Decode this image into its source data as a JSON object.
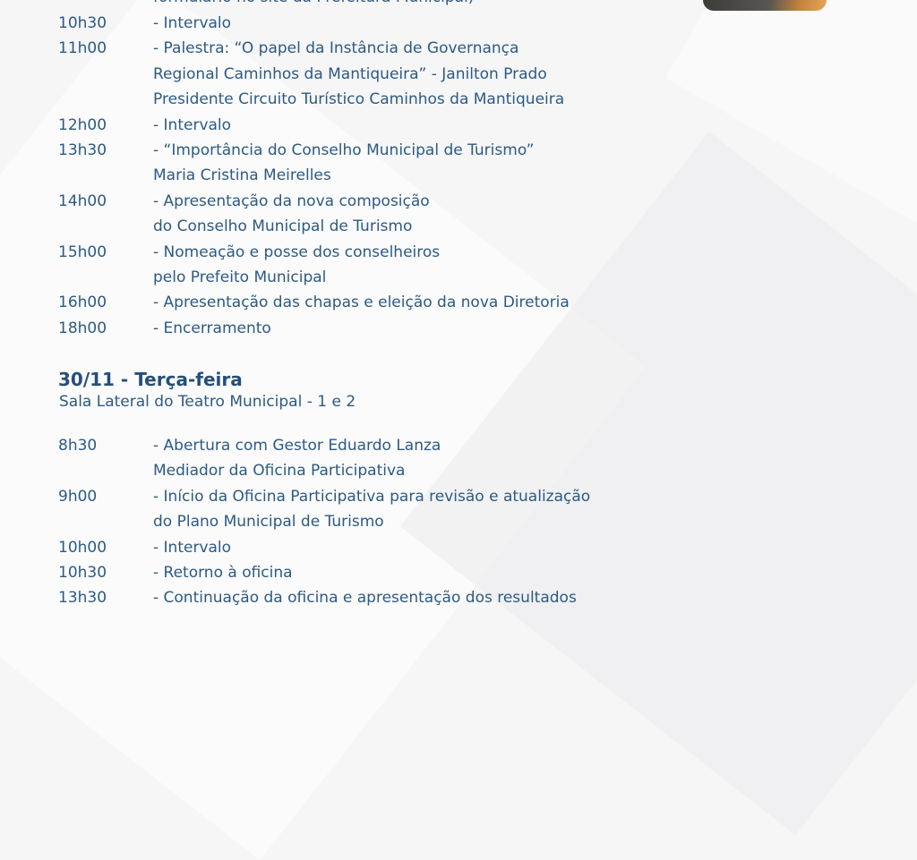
{
  "day1": {
    "partial_line": "formulário no site da Prefeitura Municipal)",
    "items": [
      {
        "time": "10h30",
        "lines": [
          "- Intervalo"
        ]
      },
      {
        "time": "11h00",
        "lines": [
          "- Palestra: “O papel da Instância de Governança",
          "Regional Caminhos da Mantiqueira” - Janilton Prado",
          "Presidente Circuito Turístico Caminhos da Mantiqueira"
        ]
      },
      {
        "time": "12h00",
        "lines": [
          "- Intervalo"
        ]
      },
      {
        "time": "13h30",
        "lines": [
          "- “Importância do Conselho Municipal de Turismo”",
          "Maria Cristina Meirelles"
        ]
      },
      {
        "time": "14h00",
        "lines": [
          "- Apresentação da nova composição",
          "do Conselho Municipal de Turismo"
        ]
      },
      {
        "time": "15h00",
        "lines": [
          "- Nomeação e posse dos conselheiros",
          "pelo Prefeito Municipal"
        ]
      },
      {
        "time": "16h00",
        "lines": [
          "- Apresentação das chapas e eleição da nova Diretoria"
        ]
      },
      {
        "time": "18h00",
        "lines": [
          "- Encerramento"
        ]
      }
    ]
  },
  "day2": {
    "title": "30/11 - Terça-feira",
    "location": "Sala Lateral do Teatro Municipal - 1 e 2",
    "items": [
      {
        "time": "8h30",
        "lines": [
          "- Abertura com Gestor Eduardo Lanza",
          "Mediador da Oficina Participativa"
        ]
      },
      {
        "time": "9h00",
        "lines": [
          "- Início da Oficina Participativa para revisão e atualização",
          "do Plano Municipal de Turismo"
        ]
      },
      {
        "time": "10h00",
        "lines": [
          "- Intervalo"
        ]
      },
      {
        "time": "10h30",
        "lines": [
          "- Retorno à oficina"
        ]
      },
      {
        "time": "13h30",
        "lines": [
          "- Continuação da oficina e apresentação dos resultados"
        ]
      }
    ]
  }
}
